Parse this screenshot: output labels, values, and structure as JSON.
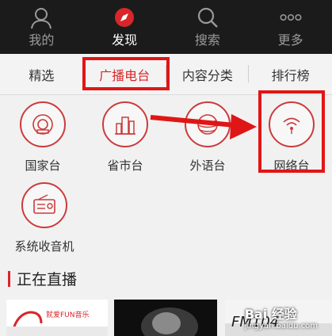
{
  "nav": {
    "items": [
      {
        "label": "我的",
        "icon": "person-icon"
      },
      {
        "label": "发现",
        "icon": "compass-icon"
      },
      {
        "label": "搜索",
        "icon": "search-icon"
      },
      {
        "label": "更多",
        "icon": "more-dots-icon"
      }
    ],
    "active": "发现"
  },
  "tabs": {
    "items": [
      {
        "label": "精选"
      },
      {
        "label": "广播电台"
      },
      {
        "label": "内容分类"
      },
      {
        "label": "排行榜"
      }
    ],
    "active": "广播电台"
  },
  "categories": [
    {
      "label": "国家台",
      "icon": "radio-icon"
    },
    {
      "label": "省市台",
      "icon": "city-icon"
    },
    {
      "label": "外语台",
      "icon": "globe-icon"
    },
    {
      "label": "网络台",
      "icon": "wifi-icon"
    },
    {
      "label": "系统收音机",
      "icon": "radio-set-icon"
    }
  ],
  "section": {
    "title": "正在直播"
  },
  "thumbs": [
    {
      "caption": "就爱FUN音乐"
    },
    {
      "caption": ""
    },
    {
      "caption": "FM104"
    }
  ],
  "watermark": {
    "brand": "Bai 经验",
    "url": "jingyan.baidu.com"
  },
  "colors": {
    "accent": "#d8262a",
    "annotation": "#e01616",
    "navbar": "#1b1b1b"
  }
}
